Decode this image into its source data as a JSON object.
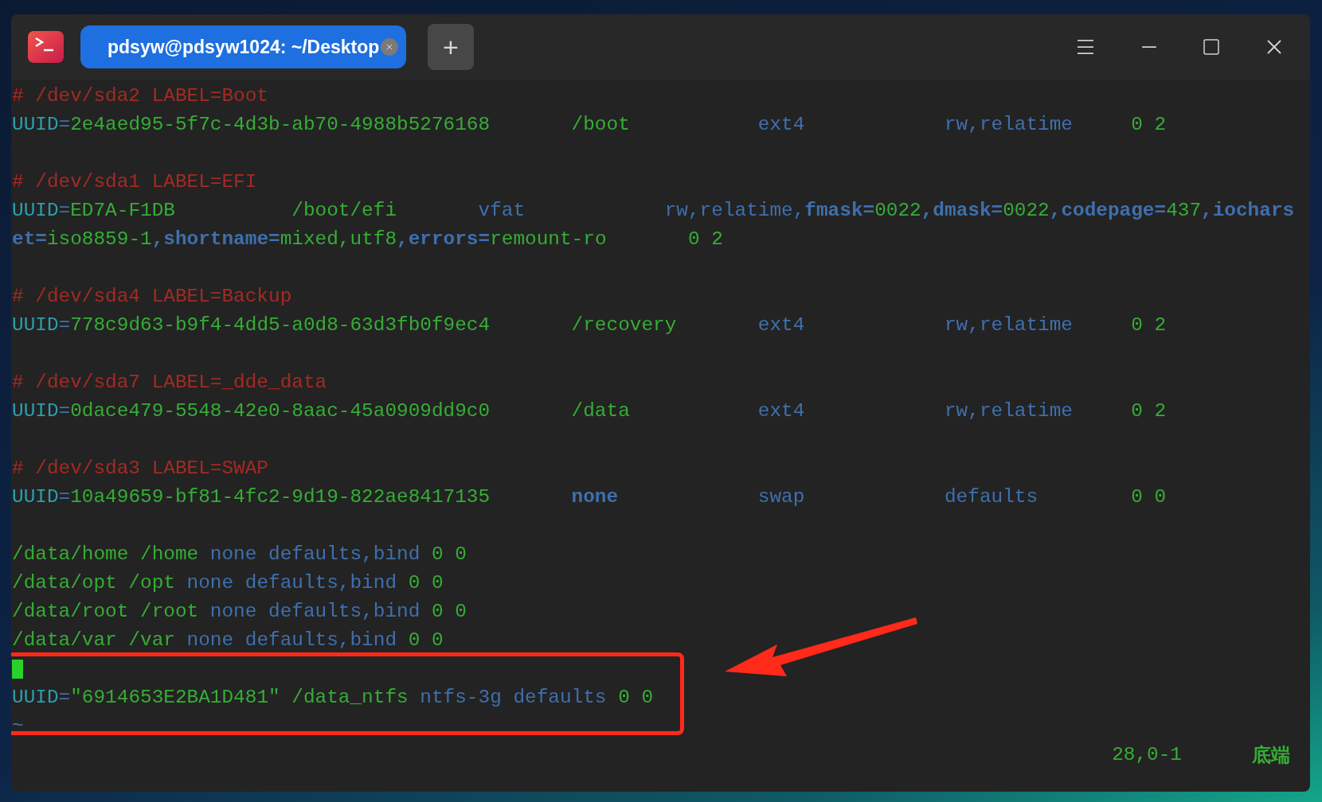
{
  "window": {
    "tabs": [
      {
        "label": "pdsyw@pdsyw1024: ~/Desktop",
        "selected": true
      }
    ],
    "new_tab": "+"
  },
  "lines": [
    {
      "kind": "text",
      "segments": [
        {
          "kind": "comment",
          "text": "# /dev/sda2 LABEL=Boot"
        }
      ]
    },
    {
      "kind": "text",
      "segments": [
        {
          "kind": "key",
          "text": "UUID"
        },
        {
          "kind": "option",
          "text": "="
        },
        {
          "kind": "value",
          "text": "2e4aed95-5f7c-4d3b-ab70-4988b5276168       /boot"
        },
        {
          "kind": "option",
          "text": "           ext4            rw,relatime"
        },
        {
          "kind": "value",
          "text": "     0 2"
        }
      ]
    },
    {
      "kind": "blank"
    },
    {
      "kind": "text",
      "segments": [
        {
          "kind": "comment",
          "text": "# /dev/sda1 LABEL=EFI"
        }
      ]
    },
    {
      "kind": "text",
      "segments": [
        {
          "kind": "key",
          "text": "UUID"
        },
        {
          "kind": "option",
          "text": "="
        },
        {
          "kind": "value",
          "text": "ED7A-F1DB          /boot/efi"
        },
        {
          "kind": "option",
          "text": "       vfat            rw,relatime,"
        },
        {
          "kind": "option-bold",
          "text": "fmask="
        },
        {
          "kind": "value",
          "text": "0022"
        },
        {
          "kind": "option-bold",
          "text": ",dmask="
        },
        {
          "kind": "value",
          "text": "0022"
        },
        {
          "kind": "option-bold",
          "text": ",codepage="
        },
        {
          "kind": "value",
          "text": "437"
        },
        {
          "kind": "option-bold",
          "text": ",iochars"
        }
      ]
    },
    {
      "kind": "text",
      "segments": [
        {
          "kind": "option-bold",
          "text": "et="
        },
        {
          "kind": "value",
          "text": "iso8859-1"
        },
        {
          "kind": "option-bold",
          "text": ",shortname="
        },
        {
          "kind": "value",
          "text": "mixed,utf8"
        },
        {
          "kind": "option-bold",
          "text": ",errors="
        },
        {
          "kind": "value",
          "text": "remount-ro       0 2"
        }
      ]
    },
    {
      "kind": "blank"
    },
    {
      "kind": "text",
      "segments": [
        {
          "kind": "comment",
          "text": "# /dev/sda4 LABEL=Backup"
        }
      ]
    },
    {
      "kind": "text",
      "segments": [
        {
          "kind": "key",
          "text": "UUID"
        },
        {
          "kind": "option",
          "text": "="
        },
        {
          "kind": "value",
          "text": "778c9d63-b9f4-4dd5-a0d8-63d3fb0f9ec4       /recovery"
        },
        {
          "kind": "option",
          "text": "       ext4            rw,relatime"
        },
        {
          "kind": "value",
          "text": "     0 2"
        }
      ]
    },
    {
      "kind": "blank"
    },
    {
      "kind": "text",
      "segments": [
        {
          "kind": "comment",
          "text": "# /dev/sda7 LABEL=_dde_data"
        }
      ]
    },
    {
      "kind": "text",
      "segments": [
        {
          "kind": "key",
          "text": "UUID"
        },
        {
          "kind": "option",
          "text": "="
        },
        {
          "kind": "value",
          "text": "0dace479-5548-42e0-8aac-45a0909dd9c0       /data"
        },
        {
          "kind": "option",
          "text": "           ext4            rw,relatime"
        },
        {
          "kind": "value",
          "text": "     0 2"
        }
      ]
    },
    {
      "kind": "blank"
    },
    {
      "kind": "text",
      "segments": [
        {
          "kind": "comment",
          "text": "# /dev/sda3 LABEL=SWAP"
        }
      ]
    },
    {
      "kind": "text",
      "segments": [
        {
          "kind": "key",
          "text": "UUID"
        },
        {
          "kind": "option",
          "text": "="
        },
        {
          "kind": "value",
          "text": "10a49659-bf81-4fc2-9d19-822ae8417135       "
        },
        {
          "kind": "option-bold",
          "text": "none"
        },
        {
          "kind": "option",
          "text": "            swap            defaults"
        },
        {
          "kind": "value",
          "text": "        0 0"
        }
      ]
    },
    {
      "kind": "blank"
    },
    {
      "kind": "text",
      "segments": [
        {
          "kind": "value",
          "text": "/data/home /home"
        },
        {
          "kind": "option",
          "text": " none defaults,bind"
        },
        {
          "kind": "value",
          "text": " 0 0"
        }
      ]
    },
    {
      "kind": "text",
      "segments": [
        {
          "kind": "value",
          "text": "/data/opt /opt"
        },
        {
          "kind": "option",
          "text": " none defaults,bind"
        },
        {
          "kind": "value",
          "text": " 0 0"
        }
      ]
    },
    {
      "kind": "text",
      "segments": [
        {
          "kind": "value",
          "text": "/data/root /root"
        },
        {
          "kind": "option",
          "text": " none defaults,bind"
        },
        {
          "kind": "value",
          "text": " 0 0"
        }
      ]
    },
    {
      "kind": "text",
      "segments": [
        {
          "kind": "value",
          "text": "/data/var /var"
        },
        {
          "kind": "option",
          "text": " none defaults,bind"
        },
        {
          "kind": "value",
          "text": " 0 0"
        }
      ]
    },
    {
      "kind": "cursor"
    },
    {
      "kind": "text",
      "segments": [
        {
          "kind": "key",
          "text": "UUID"
        },
        {
          "kind": "option",
          "text": "="
        },
        {
          "kind": "value",
          "text": "\"6914653E2BA1D481\" /data_ntfs"
        },
        {
          "kind": "option",
          "text": " ntfs-3g defaults"
        },
        {
          "kind": "value",
          "text": " 0 0"
        }
      ]
    },
    {
      "kind": "text",
      "segments": [
        {
          "kind": "tilde",
          "text": "~"
        }
      ]
    }
  ],
  "status_bar": {
    "position": "28,0-1",
    "scroll": "底端"
  }
}
